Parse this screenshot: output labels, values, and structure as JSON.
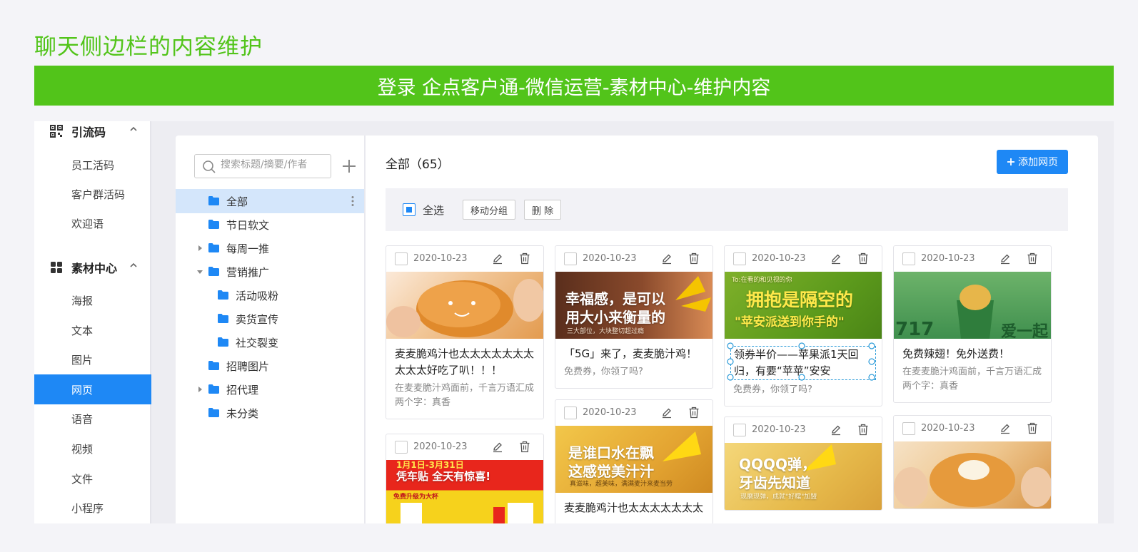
{
  "page_title": "聊天侧边栏的内容维护",
  "banner": "登录 企点客户通-微信运营-素材中心-维护内容",
  "colors": {
    "brand_green": "#52c41a",
    "primary_blue": "#1e88f5",
    "selected_bg": "#d4e6fb"
  },
  "nav": {
    "group1": {
      "label": "引流码",
      "icon": "qrcode-icon"
    },
    "group1_items": [
      "员工活码",
      "客户群活码",
      "欢迎语"
    ],
    "group2": {
      "label": "素材中心",
      "icon": "grid-icon"
    },
    "group2_items": [
      "海报",
      "文本",
      "图片",
      "网页",
      "语音",
      "视频",
      "文件",
      "小程序"
    ],
    "active": "网页"
  },
  "tree": {
    "search_placeholder": "搜索标题/摘要/作者",
    "items": [
      {
        "label": "全部",
        "level": 0,
        "selected": true
      },
      {
        "label": "节日软文",
        "level": 0
      },
      {
        "label": "每周一推",
        "level": 0,
        "caret": "collapsed"
      },
      {
        "label": "营销推广",
        "level": 0,
        "caret": "expanded"
      },
      {
        "label": "活动吸粉",
        "level": 1
      },
      {
        "label": "卖货宣传",
        "level": 1
      },
      {
        "label": "社交裂变",
        "level": 1
      },
      {
        "label": "招聘图片",
        "level": 0
      },
      {
        "label": "招代理",
        "level": 0,
        "caret": "collapsed"
      },
      {
        "label": "未分类",
        "level": 0
      }
    ]
  },
  "main": {
    "heading": "全部（65）",
    "add_button": "添加网页",
    "select_all": "全选",
    "move_group": "移动分组",
    "delete": "删 除"
  },
  "cards": [
    {
      "date": "2020-10-23",
      "title": "麦麦脆鸡汁也太太太太太太太太太太好吃了叭！！！",
      "desc": "在麦麦脆汁鸡面前，千言万语汇成两个字：真香",
      "image_text": ""
    },
    {
      "date": "2020-10-23",
      "title": "「5G」来了，麦麦脆汁鸡！",
      "desc": "免费券，你领了吗?",
      "image_text": "幸福感，是可以",
      "image_text2": "用大小来衡量的",
      "image_text3": "三大部位，大块整切超过瘾"
    },
    {
      "date": "2020-10-23",
      "title": "领券半价——苹果派1天回归，有要“苹苹”安安",
      "desc": "免费券，你领了吗?",
      "image_text": "拥抱是隔空的",
      "image_text2": "\"苹安派送到你手的\"",
      "image_text3": "To:在看的和见视的你"
    },
    {
      "date": "2020-10-23",
      "title": "免费辣翅！免外送费！",
      "desc": "在麦麦脆汁鸡面前，千言万语汇成两个字：真香",
      "image_text": "717",
      "image_text2": "爱一起"
    },
    {
      "date": "2020-10-23",
      "title": "",
      "desc": "",
      "image_text": "1月1日-3月31日",
      "image_text2": "凭车贴 全天有惊喜!",
      "image_text3": "免费升级为大杯"
    },
    {
      "date": "2020-10-23",
      "title": "麦麦脆鸡汁也太太太太太太太",
      "desc": "",
      "image_text": "是谁口水在飘",
      "image_text2": "这感觉美汁汁",
      "image_text3": "真滋味，超美味，满满麦汁来麦当劳"
    },
    {
      "date": "2020-10-23",
      "title": "",
      "desc": "",
      "image_text": "QQQQ弹，",
      "image_text2": "牙齿先知道",
      "image_text3": "现磨现弹，成就\"好糯\"加盟"
    },
    {
      "date": "2020-10-23",
      "title": "",
      "desc": "",
      "image_text": ""
    }
  ]
}
